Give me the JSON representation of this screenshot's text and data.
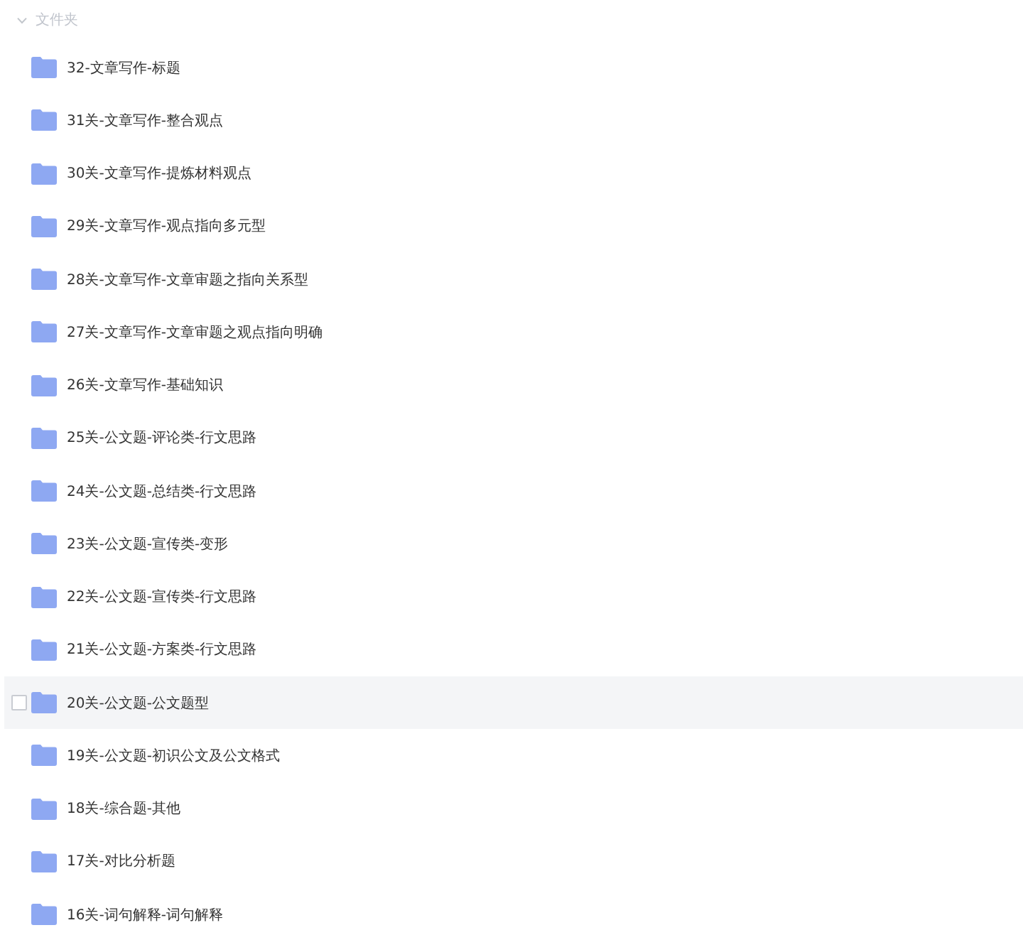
{
  "section": {
    "title": "文件夹",
    "expanded": true
  },
  "folders": [
    {
      "name": "32-文章写作-标题",
      "hovered": false
    },
    {
      "name": "31关-文章写作-整合观点",
      "hovered": false
    },
    {
      "name": "30关-文章写作-提炼材料观点",
      "hovered": false
    },
    {
      "name": "29关-文章写作-观点指向多元型",
      "hovered": false
    },
    {
      "name": "28关-文章写作-文章审题之指向关系型",
      "hovered": false
    },
    {
      "name": "27关-文章写作-文章审题之观点指向明确",
      "hovered": false
    },
    {
      "name": "26关-文章写作-基础知识",
      "hovered": false
    },
    {
      "name": "25关-公文题-评论类-行文思路",
      "hovered": false
    },
    {
      "name": "24关-公文题-总结类-行文思路",
      "hovered": false
    },
    {
      "name": "23关-公文题-宣传类-变形",
      "hovered": false
    },
    {
      "name": "22关-公文题-宣传类-行文思路",
      "hovered": false
    },
    {
      "name": "21关-公文题-方案类-行文思路",
      "hovered": false
    },
    {
      "name": "20关-公文题-公文题型",
      "hovered": true
    },
    {
      "name": "19关-公文题-初识公文及公文格式",
      "hovered": false
    },
    {
      "name": "18关-综合题-其他",
      "hovered": false
    },
    {
      "name": "17关-对比分析题",
      "hovered": false
    },
    {
      "name": "16关-词句解释-词句解释",
      "hovered": false
    }
  ]
}
